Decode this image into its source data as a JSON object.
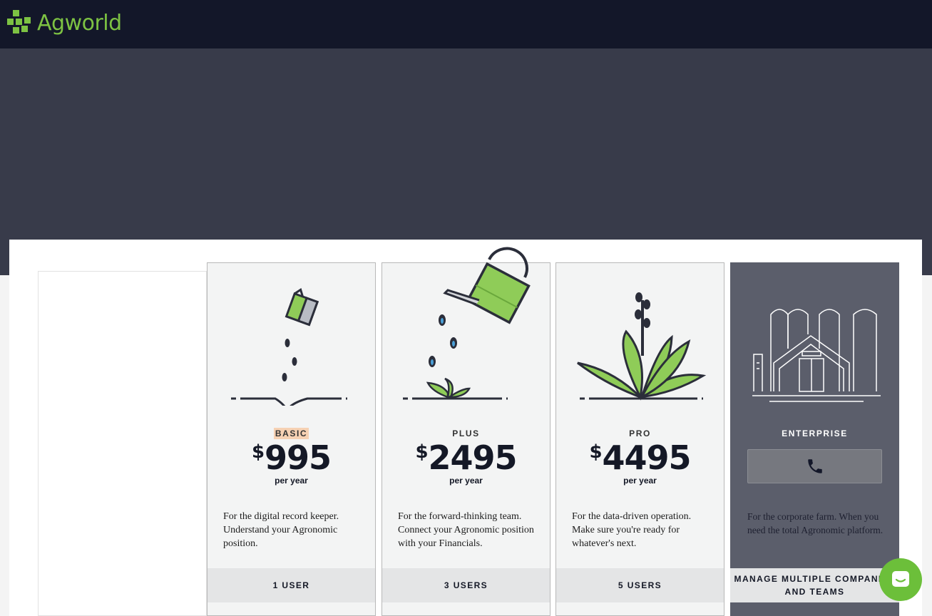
{
  "brand": {
    "name": "Agworld",
    "accent": "#7dc243"
  },
  "plans": [
    {
      "tier": "BASIC",
      "currency": "$",
      "price": "995",
      "period": "per year",
      "description": "For the digital record keeper. Understand your Agronomic position.",
      "users": "1 USER",
      "icon": "seed-packet-icon"
    },
    {
      "tier": "PLUS",
      "currency": "$",
      "price": "2495",
      "period": "per year",
      "description": "For the forward-thinking team. Connect your Agronomic position with your Financials.",
      "users": "3 USERS",
      "icon": "watering-can-icon"
    },
    {
      "tier": "PRO",
      "currency": "$",
      "price": "4495",
      "period": "per year",
      "description": "For the data-driven operation. Make sure you're ready for whatever's next.",
      "users": "5 USERS",
      "icon": "grown-plant-icon"
    }
  ],
  "enterprise": {
    "tier": "ENTERPRISE",
    "description": "For the corporate farm. When you need the total Agronomic platform.",
    "users": "MANAGE MULTIPLE COMPANIES AND TEAMS",
    "icon": "farm-silo-icon",
    "call_icon": "phone-icon"
  },
  "chat": {
    "icon": "chat-bubble-icon"
  }
}
